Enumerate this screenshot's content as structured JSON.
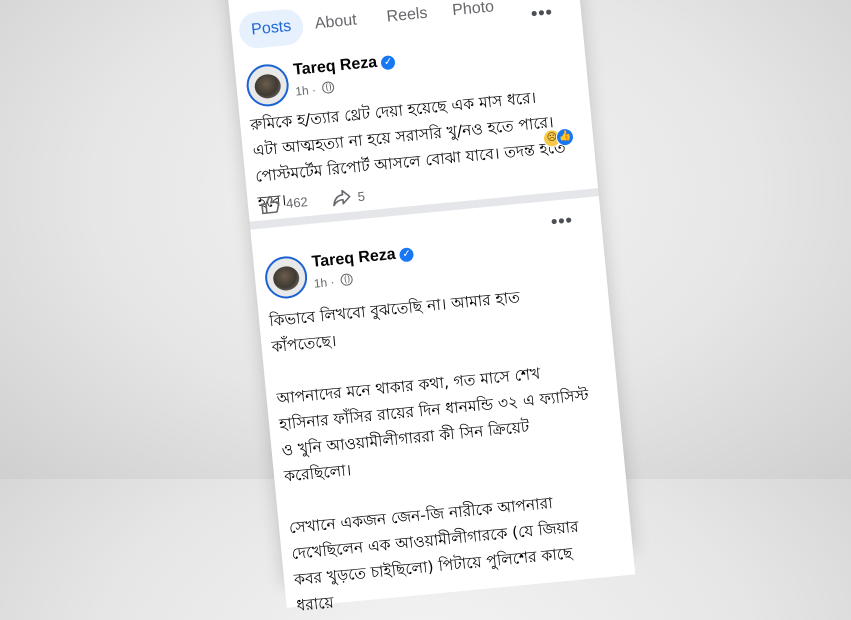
{
  "tabs": [
    {
      "label": "Posts",
      "active": true
    },
    {
      "label": "About",
      "active": false
    },
    {
      "label": "Reels",
      "active": false
    },
    {
      "label": "Photo",
      "active": false
    }
  ],
  "posts": [
    {
      "author": "Tareq Reza",
      "time": "1h",
      "paragraphs": [
        "রুমিকে হ/ত্যার থ্রেট দেয়া হয়েছে এক মাস ধরে। এটা আত্মহত্যা না হয়ে সরাসরি খু/নও হতে পারে। পোস্টমর্টেম রিপোর্ট আসলে বোঝা যাবে। তদন্ত হতে হবে।"
      ],
      "likes": "462",
      "shares": "5"
    },
    {
      "author": "Tareq Reza",
      "time": "1h",
      "paragraphs": [
        "কিভাবে লিখবো বুঝতেছি না। আমার হাত কাঁপতেছে।",
        "আপনাদের মনে থাকার কথা, গত মাসে শেখ হাসিনার ফাঁসির রায়ের দিন ধানমন্ডি ৩২ এ ফ্যাসিস্ট ও খুনি আওয়ামীলীগাররা কী সিন ক্রিয়েট করেছিলো।",
        "সেখানে একজন জেন-জি নারীকে আপনারা দেখেছিলেন এক আওয়ামীলীগারকে (যে জিয়ার কবর খুড়তে চাইছিলো) পিটায়ে পুলিশের কাছে ধরায়ে"
      ]
    }
  ],
  "icons": {
    "more": "more-options-icon",
    "verified": "verified-badge-icon",
    "audience": "globe-icon",
    "like": "like-icon",
    "share": "share-icon",
    "reactions": [
      "sad-reaction-icon",
      "like-reaction-icon"
    ]
  },
  "colors": {
    "accent": "#1877f2",
    "active_tab_bg": "#e7f0fd",
    "active_tab_text": "#1d67d6"
  }
}
